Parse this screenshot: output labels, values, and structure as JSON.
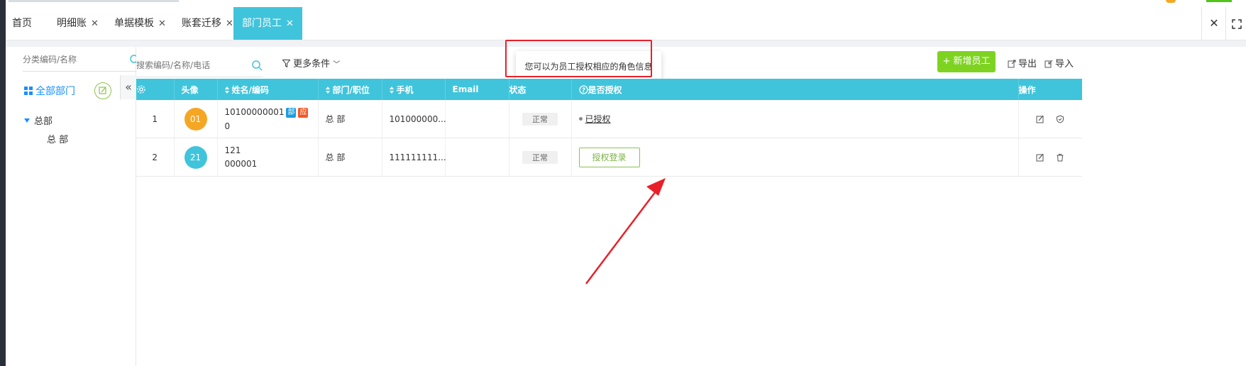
{
  "tabs": [
    {
      "label": "首页",
      "closable": false
    },
    {
      "label": "明细账",
      "closable": true
    },
    {
      "label": "单据模板",
      "closable": true
    },
    {
      "label": "账套迁移",
      "closable": true
    },
    {
      "label": "部门员工",
      "closable": true,
      "active": true
    }
  ],
  "sidebar": {
    "search_placeholder": "分类编码/名称",
    "all_dept_label": "全部部门",
    "tree": {
      "root": "总部",
      "children": [
        "总 部"
      ]
    }
  },
  "toolbar": {
    "search_placeholder": "搜索编码/名称/电话",
    "more_conditions_label": "更多条件",
    "add_employee_label": "+ 新增员工",
    "export_label": "导出",
    "import_label": "导入"
  },
  "tooltip": {
    "text": "您可以为员工授权相应的角色信息"
  },
  "table": {
    "headers": [
      "头像",
      "姓名/编码",
      "部门/职位",
      "手机",
      "Email",
      "状态",
      "是否授权",
      "操作"
    ],
    "rows": [
      {
        "index": "1",
        "avatar": "01",
        "avatar_color": "#f5a623",
        "name": "10100000001",
        "code": "0",
        "tags": [
          "部",
          "应"
        ],
        "dept": "总 部",
        "phone": "101000000...",
        "email": "",
        "status": "正常",
        "auth": "已授权",
        "auth_action": ""
      },
      {
        "index": "2",
        "avatar": "21",
        "avatar_color": "#40c4db",
        "name": "121",
        "code": "000001",
        "tags": [],
        "dept": "总 部",
        "phone": "111111111...",
        "email": "",
        "status": "正常",
        "auth": "",
        "auth_action": "授权登录"
      }
    ]
  },
  "colors": {
    "accent": "#40c4db",
    "primary_green": "#7ed321",
    "link_blue": "#1890ff",
    "annotation_red": "#e8202a",
    "tag_blue": "#1a9ee0",
    "tag_orange": "#f05a28"
  }
}
